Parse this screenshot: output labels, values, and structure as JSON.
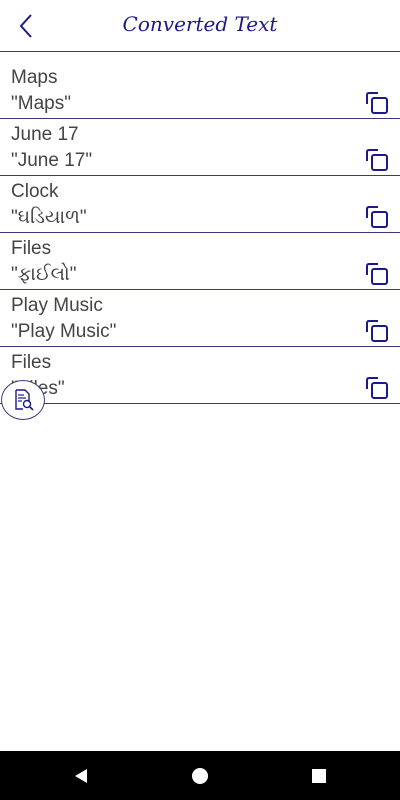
{
  "header": {
    "title": "Converted Text",
    "back_icon": "chevron-left-icon"
  },
  "items": [
    {
      "source": "Maps",
      "result": "\"Maps\""
    },
    {
      "source": "June 17",
      "result": "\"June 17\""
    },
    {
      "source": "Clock",
      "result": "\"ઘડિયાળ\""
    },
    {
      "source": "Files",
      "result": "\"ફાઈલો\""
    },
    {
      "source": "Play Music",
      "result": "\"Play Music\""
    },
    {
      "source": "Files",
      "result": "\"Files\""
    }
  ],
  "fab_icon": "document-search-icon",
  "copy_icon": "copy-icon",
  "colors": {
    "accent": "#1a1a8c",
    "divider": "#3a3a7a"
  },
  "nav": {
    "back_icon": "nav-back-icon",
    "home_icon": "nav-home-icon",
    "recents_icon": "nav-recents-icon"
  }
}
